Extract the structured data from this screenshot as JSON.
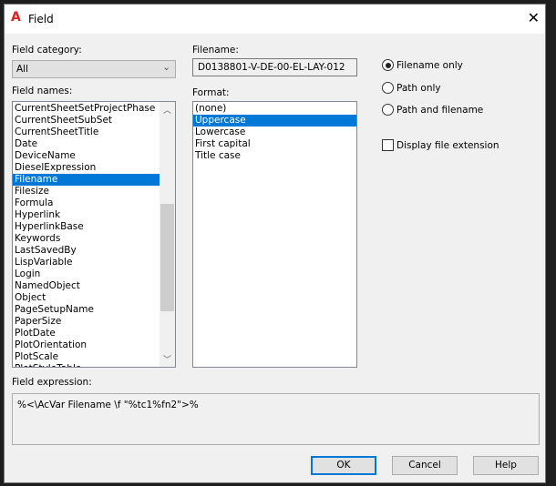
{
  "window": {
    "title": "Field",
    "close_icon": "close-icon",
    "logo": "A"
  },
  "field_category": {
    "label": "Field category:",
    "value": "All"
  },
  "field_names": {
    "label": "Field names:",
    "items": [
      "CurrentSheetSetProjectPhase",
      "CurrentSheetSubSet",
      "CurrentSheetTitle",
      "Date",
      "DeviceName",
      "DieselExpression",
      "Filename",
      "Filesize",
      "Formula",
      "Hyperlink",
      "HyperlinkBase",
      "Keywords",
      "LastSavedBy",
      "LispVariable",
      "Login",
      "NamedObject",
      "Object",
      "PageSetupName",
      "PaperSize",
      "PlotDate",
      "PlotOrientation",
      "PlotScale",
      "PlotStyleTable"
    ],
    "selected": "Filename"
  },
  "filename": {
    "label": "Filename:",
    "value": "D0138801-V-DE-00-EL-LAY-012"
  },
  "format": {
    "label": "Format:",
    "items": [
      "(none)",
      "Uppercase",
      "Lowercase",
      "First capital",
      "Title case"
    ],
    "selected": "Uppercase"
  },
  "options": {
    "radios": [
      {
        "label": "Filename only",
        "checked": true
      },
      {
        "label": "Path only",
        "checked": false
      },
      {
        "label": "Path and filename",
        "checked": false
      }
    ],
    "display_ext": {
      "label": "Display file extension",
      "checked": false
    }
  },
  "expression": {
    "label": "Field expression:",
    "value": "%<\\AcVar Filename \\f \"%tc1%fn2\">%"
  },
  "buttons": {
    "ok": "OK",
    "cancel": "Cancel",
    "help": "Help"
  },
  "colors": {
    "selection": "#0078d7",
    "logo": "#dd2222"
  }
}
